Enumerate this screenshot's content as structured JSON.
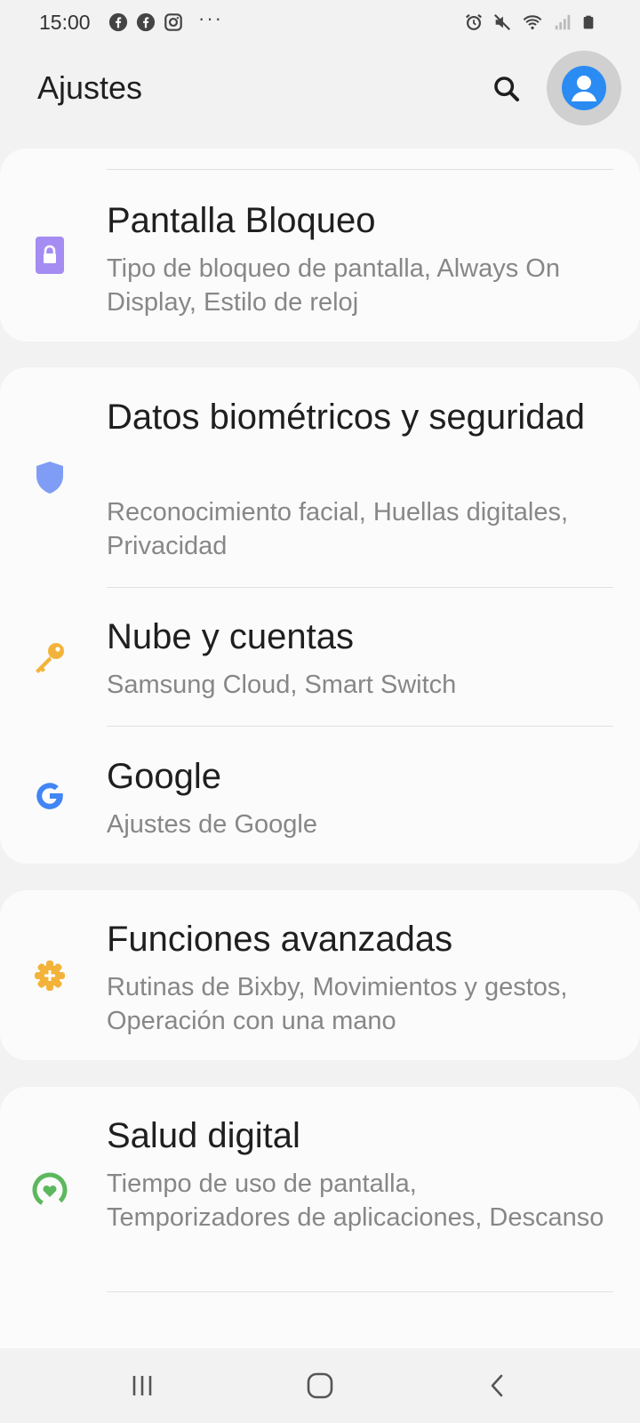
{
  "status_bar": {
    "time": "15:00",
    "left_icons": [
      "facebook-icon",
      "facebook-icon",
      "instagram-icon"
    ],
    "more": "···",
    "right_icons": [
      "alarm-icon",
      "mute-icon",
      "wifi-icon",
      "signal-icon",
      "battery-icon"
    ]
  },
  "header": {
    "title": "Ajustes"
  },
  "sections": [
    {
      "items": [
        {
          "title": "Pantalla Bloqueo",
          "subtitle": "Tipo de bloqueo de pantalla, Always On Display, Estilo de reloj",
          "icon": "lock-icon",
          "color": "#a58cf2"
        }
      ]
    },
    {
      "items": [
        {
          "title": "Datos biométricos y seguridad",
          "subtitle": "Reconocimiento facial, Huellas digitales, Privacidad",
          "icon": "shield-icon",
          "color": "#7f9df5"
        },
        {
          "title": "Nube y cuentas",
          "subtitle": "Samsung Cloud, Smart Switch",
          "icon": "key-icon",
          "color": "#f3b33a"
        },
        {
          "title": "Google",
          "subtitle": "Ajustes de Google",
          "icon": "google-icon",
          "color": "#4285f4"
        }
      ]
    },
    {
      "items": [
        {
          "title": "Funciones avanzadas",
          "subtitle": "Rutinas de Bixby, Movimientos y gestos, Operación con una mano",
          "icon": "gear-plus-icon",
          "color": "#f3b33a"
        }
      ]
    },
    {
      "items": [
        {
          "title": "Salud digital",
          "subtitle": "Tiempo de uso de pantalla, Temporizadores de aplicaciones, Descanso",
          "icon": "digital-wellbeing-icon",
          "color": "#5cb85c"
        }
      ]
    }
  ],
  "nav_bar": {
    "buttons": [
      "recents-icon",
      "home-icon",
      "back-icon"
    ]
  }
}
